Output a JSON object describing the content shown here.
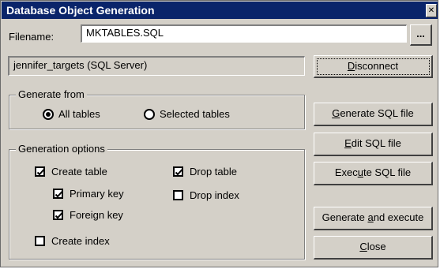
{
  "window": {
    "title": "Database Object Generation",
    "close_glyph": "✕"
  },
  "filename": {
    "label": "Filename:",
    "value": "MKTABLES.SQL",
    "browse_label": "..."
  },
  "connection": {
    "value": "jennifer_targets (SQL Server)"
  },
  "generate_from": {
    "title": "Generate from",
    "options": [
      {
        "label": "All tables",
        "selected": true
      },
      {
        "label": "Selected tables",
        "selected": false
      }
    ]
  },
  "generation_options": {
    "title": "Generation options",
    "create_table": {
      "label": "Create table",
      "checked": true
    },
    "primary_key": {
      "label": "Primary key",
      "checked": true
    },
    "foreign_key": {
      "label": "Foreign key",
      "checked": true
    },
    "create_index": {
      "label": "Create index",
      "checked": false
    },
    "drop_table": {
      "label": "Drop table",
      "checked": true
    },
    "drop_index": {
      "label": "Drop index",
      "checked": false
    }
  },
  "buttons": {
    "disconnect": {
      "pre": "",
      "key": "D",
      "post": "isconnect"
    },
    "generate_sql": {
      "pre": "",
      "key": "G",
      "post": "enerate SQL file"
    },
    "edit_sql": {
      "pre": "",
      "key": "E",
      "post": "dit SQL file"
    },
    "execute_sql": {
      "pre": "Exec",
      "key": "u",
      "post": "te SQL file"
    },
    "generate_execute": {
      "pre": "Generate ",
      "key": "a",
      "post": "nd execute"
    },
    "close": {
      "pre": "",
      "key": "C",
      "post": "lose"
    }
  },
  "colors": {
    "titlebar": "#0a246a",
    "face": "#d4d0c8"
  }
}
